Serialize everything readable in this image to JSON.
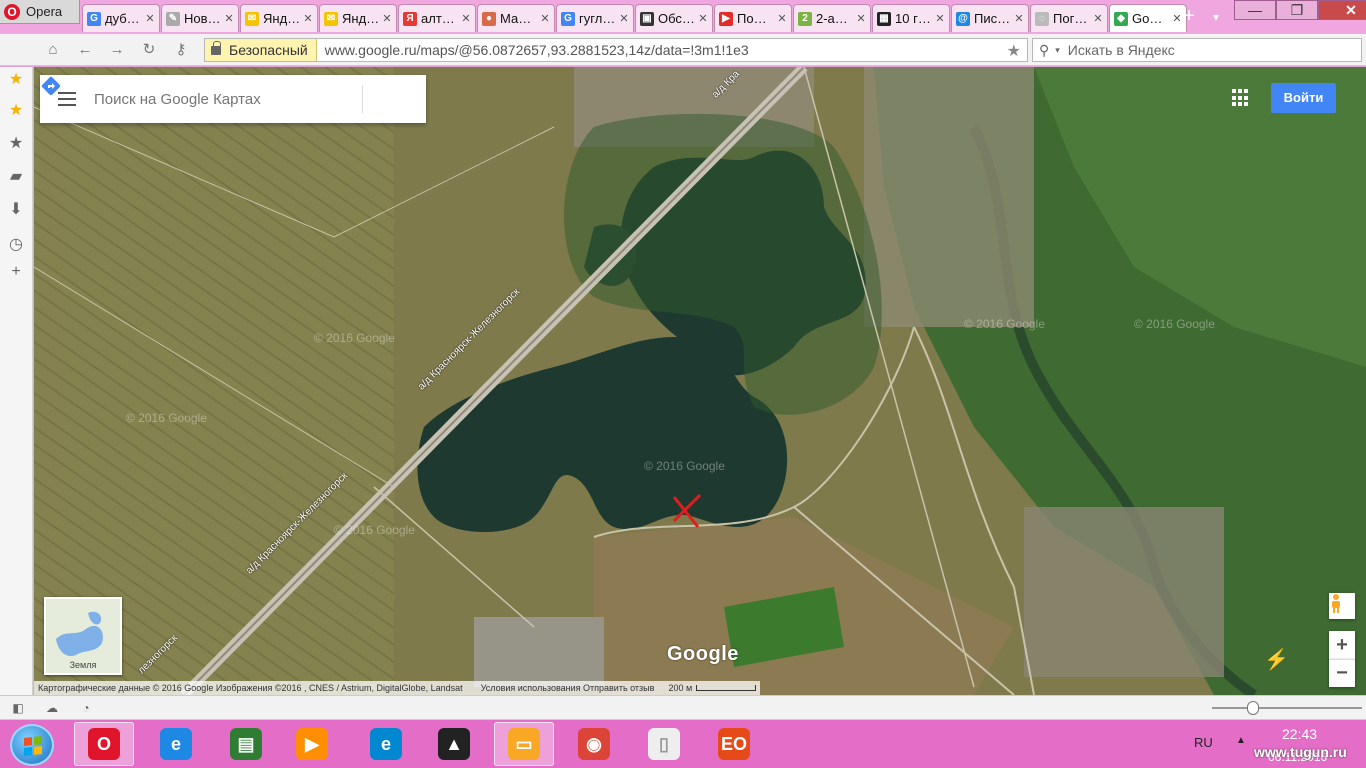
{
  "browser": {
    "menu_label": "Opera",
    "tabs": [
      {
        "label": "дуб…",
        "fav_color": "#4285f4",
        "fav_glyph": "G"
      },
      {
        "label": "Нов…",
        "fav_color": "#aaaaaa",
        "fav_glyph": "✎"
      },
      {
        "label": "Янд…",
        "fav_color": "#f5c400",
        "fav_glyph": "✉"
      },
      {
        "label": "Янд…",
        "fav_color": "#f5c400",
        "fav_glyph": "✉"
      },
      {
        "label": "алт…",
        "fav_color": "#e53935",
        "fav_glyph": "Я"
      },
      {
        "label": "Ма…",
        "fav_color": "#d86a4a",
        "fav_glyph": "●"
      },
      {
        "label": "гугл…",
        "fav_color": "#4285f4",
        "fav_glyph": "G"
      },
      {
        "label": "Обс…",
        "fav_color": "#333333",
        "fav_glyph": "▣"
      },
      {
        "label": "По…",
        "fav_color": "#e52d27",
        "fav_glyph": "▶"
      },
      {
        "label": "2-а…",
        "fav_color": "#7cb342",
        "fav_glyph": "2"
      },
      {
        "label": "10 г…",
        "fav_color": "#222222",
        "fav_glyph": "▦"
      },
      {
        "label": "Пис…",
        "fav_color": "#1e88e5",
        "fav_glyph": "@"
      },
      {
        "label": "Пог…",
        "fav_color": "#bbbbbb",
        "fav_glyph": "◌"
      },
      {
        "label": "Go…",
        "fav_color": "#34a853",
        "fav_glyph": "◆",
        "active": true
      }
    ],
    "new_tab": "+",
    "tab_menu": "▾",
    "window_controls": {
      "minimize": "—",
      "maximize": "❐",
      "close": "✕"
    }
  },
  "addressbar": {
    "secure_label": "Безопасный",
    "url": "www.google.ru/maps/@56.0872657,93.2881523,14z/data=!3m1!1e3",
    "search_placeholder": "Искать в Яндекс"
  },
  "map": {
    "search_placeholder": "Поиск на Google Картах",
    "login_label": "Войти",
    "google_label": "Google",
    "road_label_1": "а/д Красноярск-Железногорск",
    "road_label_2": "а/д Красноярск-Железногорск",
    "road_label_3": "а/д Кра",
    "road_label_4": "лезногорск",
    "watermark": "© 2016 Google",
    "minimap_label": "Земля",
    "attribution": "Картографические данные © 2016 Google Изображения ©2016 , CNES / Astrium, DigitalGlobe, Landsat",
    "attribution_links": "Условия использования   Отправить отзыв",
    "scale_label": "200 м",
    "colors": {
      "water": "#1f3a2e",
      "field": "#8a7a55",
      "forest": "#3f6a32",
      "button": "#4285f4"
    }
  },
  "taskbar": {
    "lang": "RU",
    "tray_arrow": "▲",
    "time": "22:43",
    "date": "06.11.2016",
    "watermark_site": "www.tugun.ru",
    "apps": [
      {
        "name": "opera",
        "glyph": "O",
        "color": "#e0142b",
        "active": true
      },
      {
        "name": "internet-explorer",
        "glyph": "e",
        "color": "#1e88e5"
      },
      {
        "name": "presentation",
        "glyph": "▤",
        "color": "#2e7d32"
      },
      {
        "name": "media-player",
        "glyph": "▶",
        "color": "#ff8f00"
      },
      {
        "name": "internet-explorer-2",
        "glyph": "e",
        "color": "#0288d1"
      },
      {
        "name": "archicad",
        "glyph": "▲",
        "color": "#222222"
      },
      {
        "name": "file-explorer",
        "glyph": "▭",
        "color": "#f9a825",
        "active": true
      },
      {
        "name": "chrome",
        "glyph": "◉",
        "color": "#db4437"
      },
      {
        "name": "document",
        "glyph": "▯",
        "color": "#eeeeee"
      },
      {
        "name": "eo-app",
        "glyph": "EO",
        "color": "#e64a19"
      }
    ]
  }
}
